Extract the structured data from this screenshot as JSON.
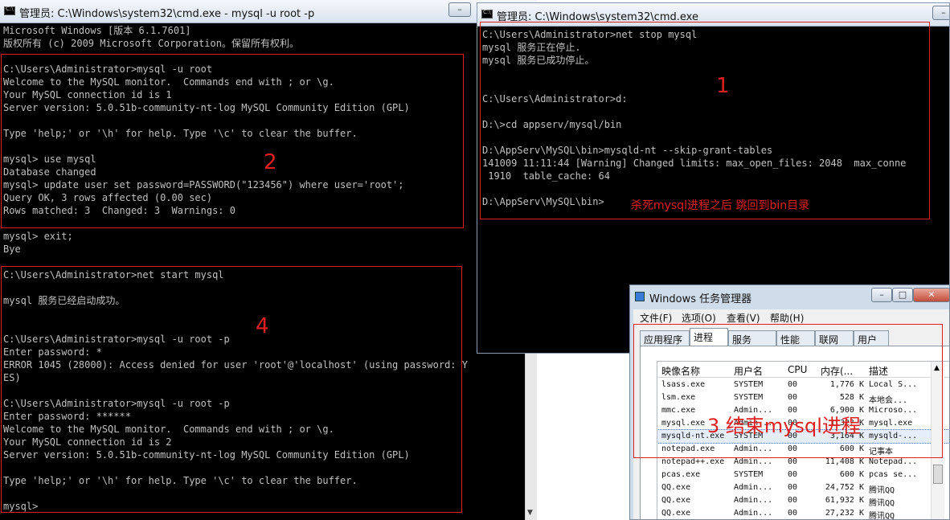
{
  "left_window": {
    "title": "管理员: C:\\Windows\\system32\\cmd.exe - mysql  -u root -p",
    "min_label": "–",
    "lines": [
      "Microsoft Windows [版本 6.1.7601]",
      "版权所有 (c) 2009 Microsoft Corporation。保留所有权利。",
      "",
      "C:\\Users\\Administrator>mysql -u root",
      "Welcome to the MySQL monitor.  Commands end with ; or \\g.",
      "Your MySQL connection id is 1",
      "Server version: 5.0.51b-community-nt-log MySQL Community Edition (GPL)",
      "",
      "Type 'help;' or '\\h' for help. Type '\\c' to clear the buffer.",
      "",
      "mysql> use mysql",
      "Database changed",
      "mysql> update user set password=PASSWORD(\"123456\") where user='root';",
      "Query OK, 3 rows affected (0.00 sec)",
      "Rows matched: 3  Changed: 3  Warnings: 0",
      "",
      "mysql> exit;",
      "Bye",
      "",
      "C:\\Users\\Administrator>net start mysql",
      "",
      "mysql 服务已经启动成功。",
      "",
      "",
      "C:\\Users\\Administrator>mysql -u root -p",
      "Enter password: *",
      "ERROR 1045 (28000): Access denied for user 'root'@'localhost' (using password: Y",
      "ES)",
      "",
      "C:\\Users\\Administrator>mysql -u root -p",
      "Enter password: ******",
      "Welcome to the MySQL monitor.  Commands end with ; or \\g.",
      "Your MySQL connection id is 2",
      "Server version: 5.0.51b-community-nt-log MySQL Community Edition (GPL)",
      "",
      "Type 'help;' or '\\h' for help. Type '\\c' to clear the buffer.",
      "",
      "mysql>"
    ]
  },
  "right_window": {
    "title": "管理员: C:\\Windows\\system32\\cmd.exe",
    "min_label": "–",
    "lines": [
      "C:\\Users\\Administrator>net stop mysql",
      "mysql 服务正在停止.",
      "mysql 服务已成功停止。",
      "",
      "",
      "C:\\Users\\Administrator>d:",
      "",
      "D:\\>cd appserv/mysql/bin",
      "",
      "D:\\AppServ\\MySQL\\bin>mysqld-nt --skip-grant-tables",
      "141009 11:11:44 [Warning] Changed limits: max_open_files: 2048  max_conne",
      " 1910  table_cache: 64",
      "",
      "D:\\AppServ\\MySQL\\bin>"
    ]
  },
  "annotations": {
    "n1": "1",
    "n2": "2",
    "n3": "3 结束mysql进程",
    "n4": "4",
    "note": "杀死mysql进程之后 跳回到bin目录",
    "color": "#e02020"
  },
  "task_manager": {
    "title": "Windows 任务管理器",
    "menus": [
      "文件(F)",
      "选项(O)",
      "查看(V)",
      "帮助(H)"
    ],
    "tabs": [
      "应用程序",
      "进程",
      "服务",
      "性能",
      "联网",
      "用户"
    ],
    "active_tab": "进程",
    "columns": [
      "映像名称",
      "用户名",
      "CPU",
      "内存(...",
      "描述"
    ],
    "rows": [
      [
        "lsass.exe",
        "SYSTEM",
        "00",
        "1,776 K",
        "Local S..."
      ],
      [
        "lsm.exe",
        "SYSTEM",
        "00",
        "528 K",
        "本地会..."
      ],
      [
        "mmc.exe",
        "Admin...",
        "00",
        "6,900 K",
        "Microso..."
      ],
      [
        "mysql.exe",
        "Admin...",
        "00",
        "1,32? K",
        "mysql.exe"
      ],
      [
        "mysqld-nt.exe",
        "SYSTEM",
        "00",
        "3,164 K",
        "mysqld-..."
      ],
      [
        "notepad.exe",
        "Admin...",
        "00",
        "600 K",
        "记事本"
      ],
      [
        "notepad++.exe",
        "Admin...",
        "00",
        "11,408 K",
        "Notepad..."
      ],
      [
        "pcas.exe",
        "SYSTEM",
        "00",
        "600 K",
        "pcas se..."
      ],
      [
        "QQ.exe",
        "Admin...",
        "00",
        "24,752 K",
        "腾讯QQ"
      ],
      [
        "QQ.exe",
        "Admin...",
        "00",
        "61,932 K",
        "腾讯QQ"
      ],
      [
        "QQ.exe",
        "Admin...",
        "00",
        "27,232 K",
        "腾讯QQ"
      ]
    ],
    "selected_row": 4
  }
}
